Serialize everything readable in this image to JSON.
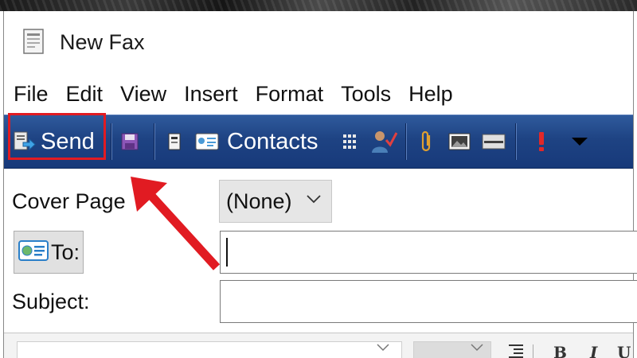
{
  "window": {
    "title": "New Fax"
  },
  "menu": {
    "items": [
      "File",
      "Edit",
      "View",
      "Insert",
      "Format",
      "Tools",
      "Help"
    ]
  },
  "toolbar": {
    "send_label": "Send",
    "contacts_label": "Contacts",
    "buttons": [
      "send",
      "save",
      "attach-file",
      "contacts",
      "select-names",
      "check-names",
      "attach-item",
      "insert-picture",
      "insert-line",
      "importance-high",
      "options-dropdown"
    ]
  },
  "form": {
    "cover_page_label": "Cover Page",
    "cover_page_value": "(None)",
    "to_label": "To:",
    "to_value": "",
    "subject_label": "Subject:",
    "subject_value": ""
  },
  "annotation": {
    "highlight_color": "#e11b22",
    "highlighted": "send-button"
  },
  "colors": {
    "toolbar_bg": "#1e4383",
    "annotation_red": "#e11b22"
  }
}
